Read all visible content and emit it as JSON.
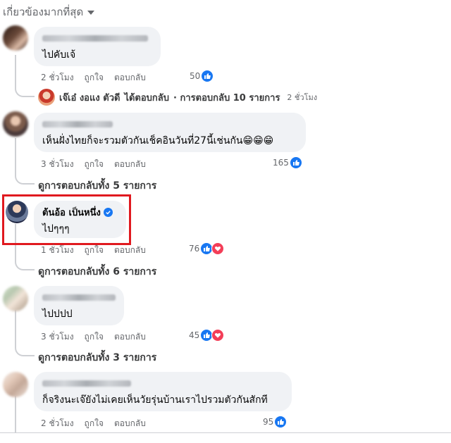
{
  "sort": {
    "label": "เกี่ยวข้องมากที่สุด"
  },
  "comments": [
    {
      "text": "ไปคับเจ้",
      "time": "2 ชั่วโมง",
      "like": "ถูกใจ",
      "reply": "ตอบกลับ",
      "reactions_count": "50",
      "reply_preview": {
        "author": "เจ๊เอ๋ งอแง ตัวดี",
        "action": "ได้ตอบกลับ",
        "summary": "· การตอบกลับ 10 รายการ",
        "time": "2 ชั่วโมง"
      }
    },
    {
      "text": "เห็นฝั่งไทยก็จะรวมตัวกันเช็คอินวันที่27นี้เช่นกัน😁😁😁",
      "time": "3 ชั่วโมง",
      "like": "ถูกใจ",
      "reply": "ตอบกลับ",
      "reactions_count": "165",
      "view_replies": "ดูการตอบกลับทั้ง 5 รายการ"
    },
    {
      "author": "ต้นอ้อ เป็นหนึ่ง",
      "text": "ไปๆๆๆ",
      "time": "1 ชั่วโมง",
      "like": "ถูกใจ",
      "reply": "ตอบกลับ",
      "reactions_count": "76",
      "view_replies": "ดูการตอบกลับทั้ง 6 รายการ"
    },
    {
      "text": "ไปปปป",
      "time": "3 ชั่วโมง",
      "like": "ถูกใจ",
      "reply": "ตอบกลับ",
      "reactions_count": "45",
      "view_replies": "ดูการตอบกลับทั้ง 3 รายการ"
    },
    {
      "text": "ก็จริงนะเจ๊ยังไม่เคยเห็นวัยรุ่นบ้านเราไปรวมตัวกันสักที",
      "time": "2 ชั่วโมง",
      "like": "ถูกใจ",
      "reply": "ตอบกลับ",
      "reactions_count": "95"
    }
  ],
  "colors": {
    "like_blue": "#1877f2",
    "love_red": "#f33e58",
    "highlight_red": "#e0191f",
    "bubble_gray": "#f0f2f5"
  }
}
